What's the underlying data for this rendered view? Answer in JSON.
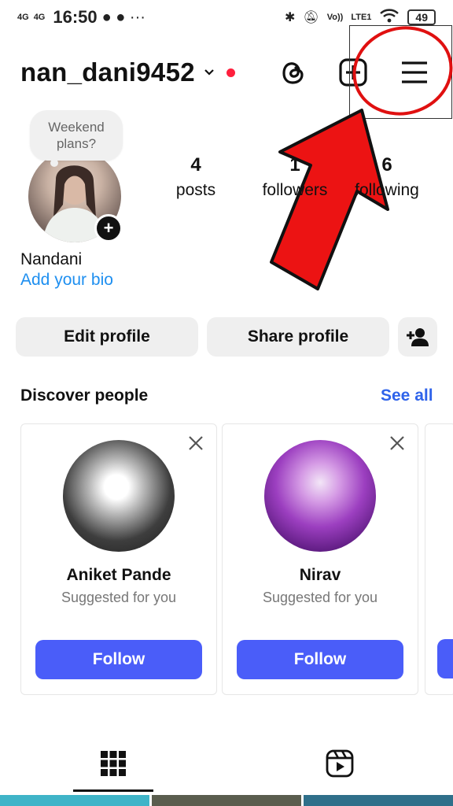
{
  "status_bar": {
    "network_1": "4G",
    "network_2": "4G",
    "time": "16:50",
    "volte": "Vo))",
    "lte": "LTE1",
    "battery": "49"
  },
  "header": {
    "username": "nan_dani9452"
  },
  "profile": {
    "note": "Weekend plans?",
    "name": "Nandani",
    "bio_link": "Add your bio",
    "stats": [
      {
        "value": "4",
        "label": "posts"
      },
      {
        "value": "1",
        "label": "followers"
      },
      {
        "value": "6",
        "label": "following"
      }
    ]
  },
  "buttons": {
    "edit_profile": "Edit profile",
    "share_profile": "Share profile"
  },
  "discover": {
    "title": "Discover people",
    "see_all": "See all",
    "cards": [
      {
        "name": "Aniket Pande",
        "subtitle": "Suggested for you",
        "button": "Follow"
      },
      {
        "name": "Nirav",
        "subtitle": "Suggested for you",
        "button": "Follow"
      }
    ]
  },
  "colors": {
    "accent_blue": "#4a5df9",
    "link_blue": "#1e8ff0",
    "annotation_red": "#e01010"
  },
  "icons": [
    "threads-icon",
    "create-post-icon",
    "menu-icon",
    "chevron-down-icon",
    "add-person-icon",
    "close-icon",
    "grid-icon",
    "reels-icon"
  ]
}
